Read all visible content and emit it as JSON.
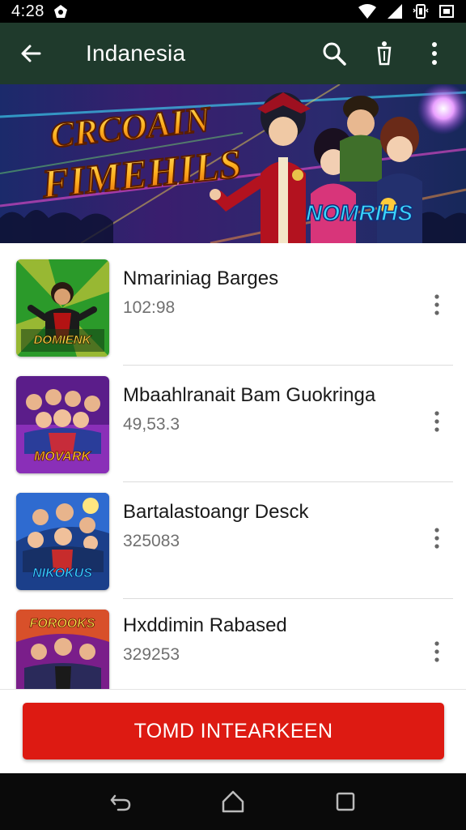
{
  "status_bar": {
    "time": "4:28",
    "icons": [
      "notification-icon",
      "wifi-icon",
      "signal-icon",
      "vibrate-icon",
      "battery-icon"
    ]
  },
  "app_bar": {
    "title": "Indanesia",
    "back_icon": "arrow-left-icon",
    "actions": [
      "search-icon",
      "filter-icon",
      "more-vert-icon"
    ],
    "background": "#1f3a2c"
  },
  "hero": {
    "title_line1": "CRCOAIN",
    "title_line2": "FIMEHILS",
    "badge": "NOMRIHS"
  },
  "games": [
    {
      "name": "Nmariniag Barges",
      "meta": "102:98"
    },
    {
      "name": "Mbaahlranait Bam Guokringa",
      "meta": "49,53.3"
    },
    {
      "name": "Bartalastoangr Desck",
      "meta": "325083"
    },
    {
      "name": "Hxddimin Rabased",
      "meta": "329253"
    }
  ],
  "thumb_labels": [
    "DOMIENK",
    "MOVARK",
    "NIKOKUS",
    "FOROOKS"
  ],
  "primary_button": {
    "label": "TOMD  INTEARKEEN",
    "color": "#dd1a12"
  },
  "nav_bar": {
    "icons": [
      "back-nav-icon",
      "home-nav-icon",
      "recents-nav-icon"
    ]
  }
}
